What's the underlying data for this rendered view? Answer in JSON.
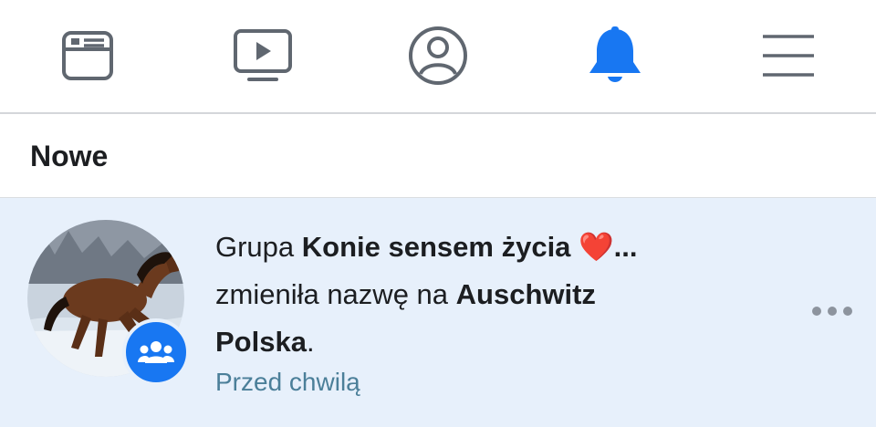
{
  "nav": {
    "items": [
      {
        "icon": "news-feed-icon",
        "active": false
      },
      {
        "icon": "video-icon",
        "active": false
      },
      {
        "icon": "profile-icon",
        "active": false
      },
      {
        "icon": "bell-icon",
        "active": true
      },
      {
        "icon": "menu-icon",
        "active": false
      }
    ],
    "active_color": "#1877f2",
    "inactive_color": "#606770"
  },
  "section": {
    "title": "Nowe"
  },
  "notification": {
    "prefix": "Grupa ",
    "old_name": "Konie sensem życia",
    "heart": "❤️",
    "ellipsis": "...",
    "middle": " zmieniła nazwę na ",
    "new_name": "Auschwitz Polska",
    "suffix": ".",
    "time": "Przed chwilą",
    "badge_icon": "group-icon",
    "more_icon": "more-options-icon",
    "background_color": "#e7f0fb",
    "time_color": "#4b7f99"
  }
}
